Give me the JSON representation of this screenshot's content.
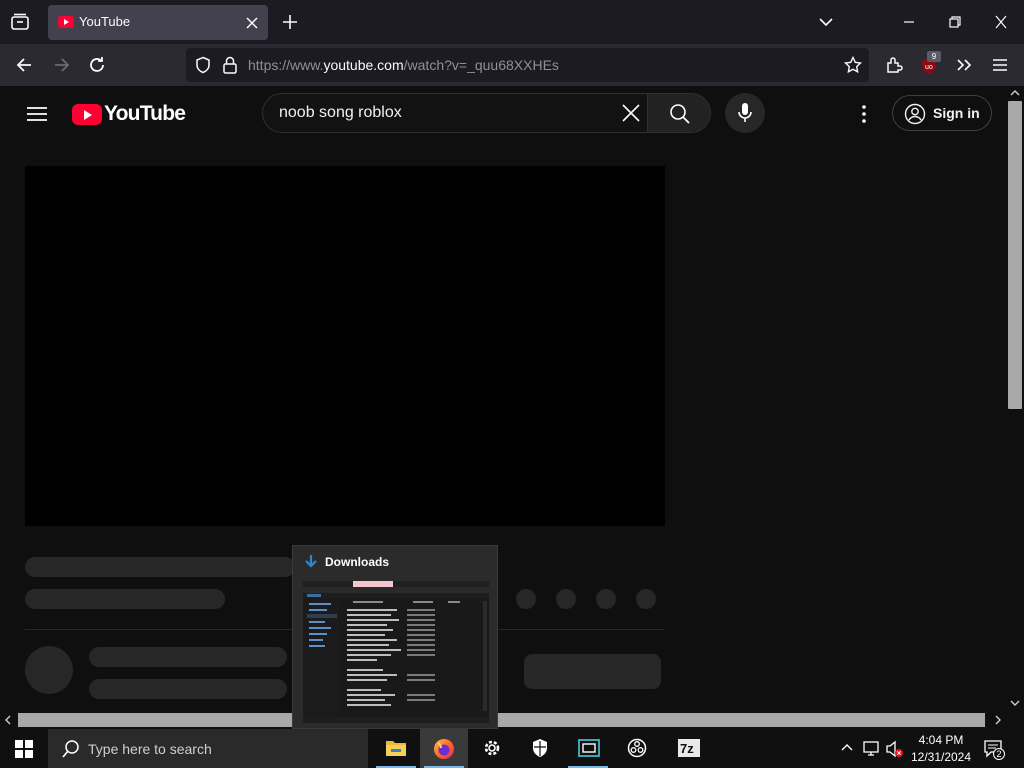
{
  "browser": {
    "tab": {
      "title": "YouTube"
    },
    "url": {
      "prefix": "https://www.",
      "host": "youtube.com",
      "path": "/watch?v=_quu68XXHEs"
    },
    "extension_badge": "9",
    "colors": {
      "tabstrip": "#1c1b22",
      "toolbar": "#2b2a33",
      "accent": "#ff0033"
    }
  },
  "youtube": {
    "logo_text": "YouTube",
    "search_value": "noob song roblox",
    "sign_in_label": "Sign in"
  },
  "downloads_preview": {
    "title": "Downloads"
  },
  "taskbar": {
    "search_placeholder": "Type here to search",
    "apps": [
      "file-explorer",
      "firefox",
      "settings",
      "security",
      "capture",
      "obs",
      "7zip"
    ],
    "clock_time": "4:04 PM",
    "clock_date": "12/31/2024",
    "notification_count": "2"
  }
}
